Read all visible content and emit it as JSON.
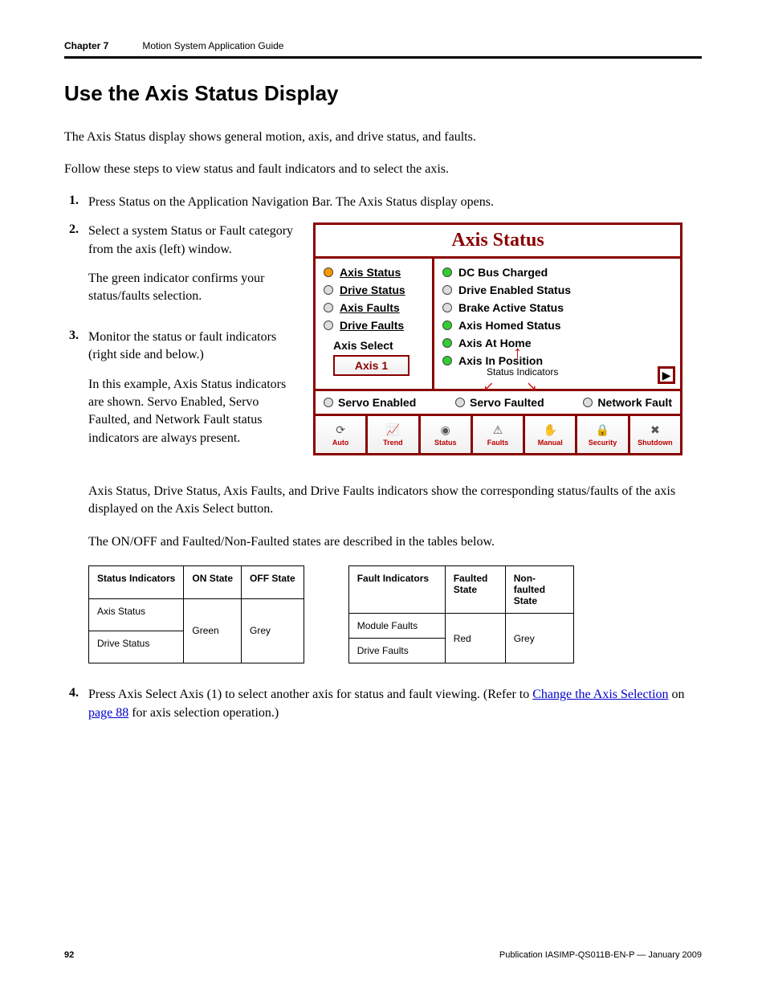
{
  "header": {
    "chapter": "Chapter 7",
    "title": "Motion System Application Guide"
  },
  "heading": "Use the Axis Status Display",
  "intro1": "The Axis Status display shows general motion, axis, and drive status, and faults.",
  "intro2": "Follow these steps to view status and fault indicators and to select the axis.",
  "steps": {
    "s1": {
      "num": "1.",
      "text": "Press Status on the Application Navigation Bar. The Axis Status display opens."
    },
    "s2": {
      "num": "2.",
      "p1": "Select a system Status or Fault category from the axis (left) window.",
      "p2": "The green indicator confirms your status/faults selection."
    },
    "s3": {
      "num": "3.",
      "p1": "Monitor the status or fault indicators (right side and below.)",
      "p2": "In this example, Axis Status indicators are shown. Servo Enabled, Servo Faulted, and Network Fault status indicators are always present."
    },
    "s4": {
      "num": "4.",
      "prefix": "Press Axis Select Axis (1) to select another axis for status and fault viewing. (Refer to ",
      "link1": "Change the Axis Selection",
      "mid": " on ",
      "link2": "page 88",
      "suffix": " for axis selection operation.)"
    }
  },
  "panel": {
    "title": "Axis Status",
    "left": {
      "axis_status": "Axis Status",
      "drive_status": "Drive Status",
      "axis_faults": "Axis Faults",
      "drive_faults": "Drive Faults",
      "axis_select": "Axis Select",
      "axis_select_btn": "Axis 1"
    },
    "right": {
      "r1": "DC Bus Charged",
      "r2": "Drive Enabled Status",
      "r3": "Brake Active Status",
      "r4": "Axis Homed Status",
      "r5": "Axis At Home",
      "r6": "Axis In Position",
      "status_indicators": "Status Indicators"
    },
    "servo": {
      "enabled": "Servo Enabled",
      "faulted": "Servo Faulted",
      "network": "Network Fault"
    },
    "nav": {
      "auto": "Auto",
      "trend": "Trend",
      "status": "Status",
      "faults": "Faults",
      "manual": "Manual",
      "security": "Security",
      "shutdown": "Shutdown"
    }
  },
  "mid": {
    "p1": "Axis Status, Drive Status, Axis Faults, and Drive Faults indicators show the corresponding status/faults of the axis displayed on the Axis Select button.",
    "p2": "The ON/OFF and Faulted/Non-Faulted states are described in the tables below."
  },
  "table1": {
    "h1": "Status Indicators",
    "h2": "ON State",
    "h3": "OFF State",
    "r1c1": "Axis Status",
    "r2c1": "Drive Status",
    "merge2": "Green",
    "merge3": "Grey"
  },
  "table2": {
    "h1": "Fault Indicators",
    "h2": "Faulted State",
    "h3": "Non-faulted State",
    "r1c1": "Module Faults",
    "r2c1": "Drive Faults",
    "merge2": "Red",
    "merge3": "Grey"
  },
  "footer": {
    "page": "92",
    "pub": "Publication IASIMP-QS011B-EN-P — January 2009"
  }
}
